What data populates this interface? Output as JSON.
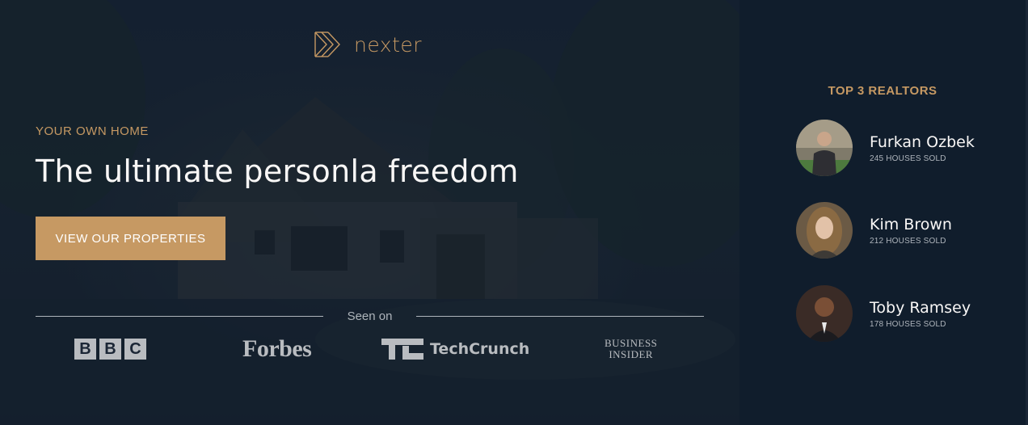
{
  "brand": {
    "name": "nexter",
    "accent": "#c69963",
    "dark": "#101d2c"
  },
  "hero": {
    "eyebrow": "YOUR OWN HOME",
    "headline": "The ultimate personla freedom",
    "cta_label": "VIEW OUR PROPERTIES",
    "seen_on_label": "Seen on",
    "press_logos": [
      {
        "name": "BBC",
        "letters": [
          "B",
          "B",
          "C"
        ]
      },
      {
        "name": "Forbes"
      },
      {
        "name": "TechCrunch"
      },
      {
        "name": "Business Insider",
        "lines": [
          "BUSINESS",
          "INSIDER"
        ]
      }
    ]
  },
  "sidebar": {
    "title": "TOP 3 REALTORS",
    "realtors": [
      {
        "name": "Furkan Ozbek",
        "sold": "245 HOUSES SOLD"
      },
      {
        "name": "Kim Brown",
        "sold": "212 HOUSES SOLD"
      },
      {
        "name": "Toby Ramsey",
        "sold": "178 HOUSES SOLD"
      }
    ]
  }
}
